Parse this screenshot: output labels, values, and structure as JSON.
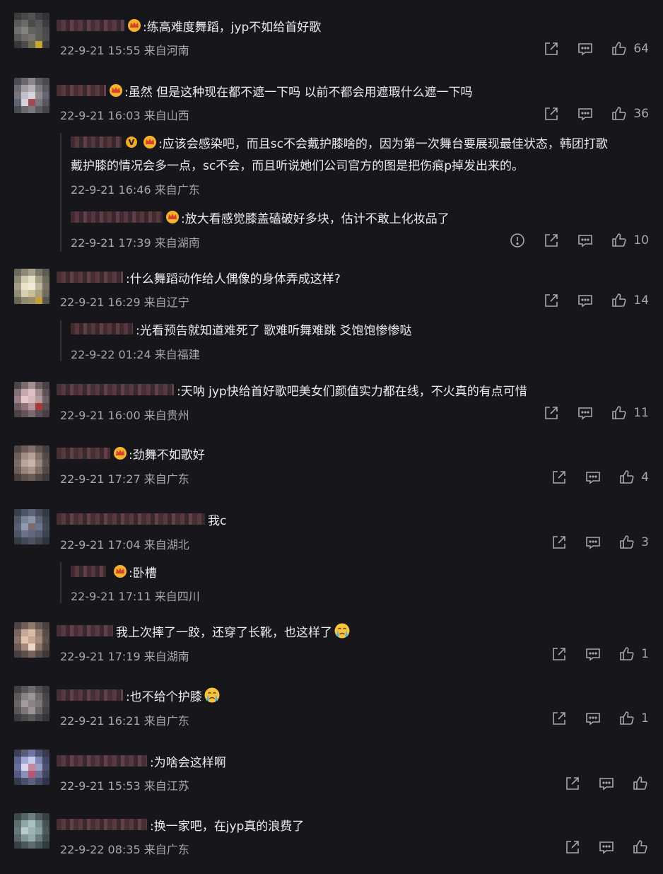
{
  "comments": [
    {
      "text": ":练高难度舞蹈，jyp不如给首好歌",
      "meta": "22-9-21 15:55 来自河南",
      "likes": "64"
    },
    {
      "text": ":虽然 但是这种现在都不遮一下吗 以前不都会用遮瑕什么遮一下吗",
      "meta": "22-9-21 16:03 来自山西",
      "likes": "36",
      "replies": [
        {
          "text": ":应该会感染吧，而且sc不会戴护膝啥的，因为第一次舞台要展现最佳状态，韩团打歌",
          "text2": "戴护膝的情况会多一点，sc不会，而且听说她们公司官方的图是把伤痕p掉发出来的。",
          "meta": "22-9-21 16:46 来自广东"
        },
        {
          "text": ":放大看感觉膝盖磕破好多块，估计不敢上化妆品了",
          "meta": "22-9-21 17:39 来自湖南",
          "likes": "10"
        }
      ]
    },
    {
      "text": ":什么舞蹈动作给人偶像的身体弄成这样?",
      "meta": "22-9-21 16:29 来自辽宁",
      "likes": "14",
      "replies": [
        {
          "text": ":光看预告就知道难死了 歌难听舞难跳 爻饱饱惨惨哒",
          "meta": "22-9-22 01:24 来自福建"
        }
      ]
    },
    {
      "text": ":天呐  jyp快给首好歌吧美女们颜值实力都在线，不火真的有点可惜",
      "meta": "22-9-21 16:00 来自贵州",
      "likes": "11"
    },
    {
      "text": ":劲舞不如歌好",
      "meta": "22-9-21 17:27 来自广东",
      "likes": "4"
    },
    {
      "text": "我c",
      "meta": "22-9-21 17:04 来自湖北",
      "likes": "3",
      "replies": [
        {
          "text": ":卧槽",
          "meta": "22-9-21 17:11 来自四川"
        }
      ]
    },
    {
      "text": "我上次摔了一跤，还穿了长靴，也这样了",
      "meta": "22-9-21 17:19 来自湖南",
      "likes": "1"
    },
    {
      "text": ":也不给个护膝",
      "meta": "22-9-21 16:21 来自广东",
      "likes": "1"
    },
    {
      "text": ":为啥会这样啊",
      "meta": "22-9-21 15:53 来自江苏",
      "likes": ""
    },
    {
      "text": ":换一家吧，在jyp真的浪费了",
      "meta": "22-9-22 08:35 来自广东",
      "likes": ""
    }
  ],
  "icons": {
    "share": "share-icon",
    "reply": "comment-icon",
    "like": "thumbs-up-icon",
    "report": "report-icon",
    "crown": "crown-badge-icon",
    "verified": "verified-badge-icon",
    "cry": "crying-emoji-icon"
  },
  "colors": {
    "background": "#17161b",
    "text": "#e6e6e6",
    "meta": "#a8a8a8",
    "badge": "#f0a928"
  }
}
